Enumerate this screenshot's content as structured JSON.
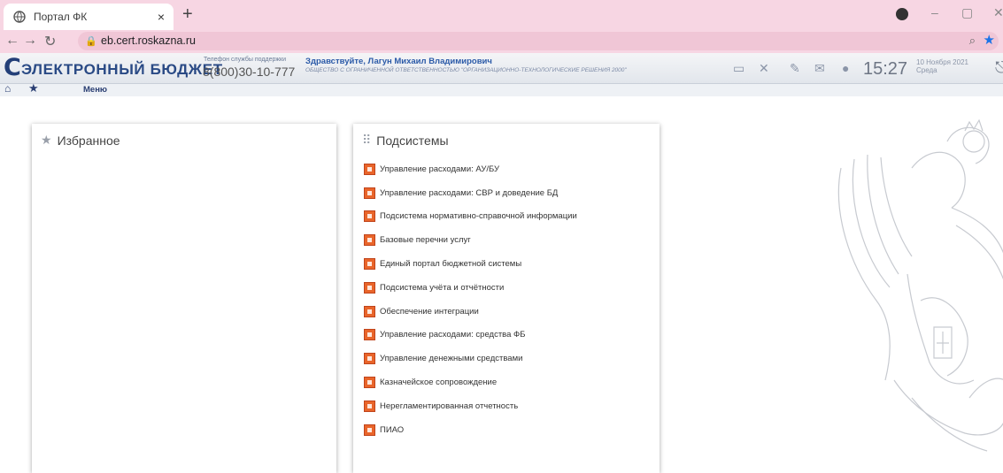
{
  "browser": {
    "tab_title": "Портал ФК",
    "tab_close": "×",
    "new_tab": "+",
    "minimize": "–",
    "maximize": "▢",
    "close": "✕",
    "url": "eb.cert.roskazna.ru"
  },
  "header": {
    "logo_letter": "С",
    "logo_text": "ЭЛЕКТРОННЫЙ БЮДЖЕТ",
    "support_label": "Телефон службы поддержки",
    "support_phone": "8(800)30-10-777",
    "greeting": "Здравствуйте, Лагун Михаил Владимирович",
    "organization": "ОБЩЕСТВО С ОГРАНИЧЕННОЙ ОТВЕТСТВЕННОСТЬЮ \"ОРГАНИЗАЦИОННО-ТЕХНОЛОГИЧЕСКИЕ РЕШЕНИЯ 2000\"",
    "time": "15:27",
    "date": "10 Ноября 2021",
    "weekday": "Среда",
    "icons": [
      "id-card-icon",
      "tools-icon",
      "edit-icon",
      "mail-icon",
      "user-icon",
      "exit-icon"
    ]
  },
  "menubar": {
    "menu_label": "Меню"
  },
  "favorites": {
    "title": "Избранное"
  },
  "subsystems": {
    "title": "Подсистемы",
    "items": [
      "Управление расходами: АУ/БУ",
      "Управление расходами: СВР и доведение БД",
      "Подсистема нормативно-справочной информации",
      "Базовые перечни услуг",
      "Единый портал бюджетной системы",
      "Подсистема учёта и отчётности",
      "Обеспечение интеграции",
      "Управление расходами: средства ФБ",
      "Управление денежными средствами",
      "Казначейское сопровождение",
      "Нерегламентированная отчетность",
      "ПИАО"
    ]
  },
  "colors": {
    "browser_chrome": "#f7d6e3",
    "brand": "#2a4a85",
    "subsystem_icon": "#e9652a"
  }
}
